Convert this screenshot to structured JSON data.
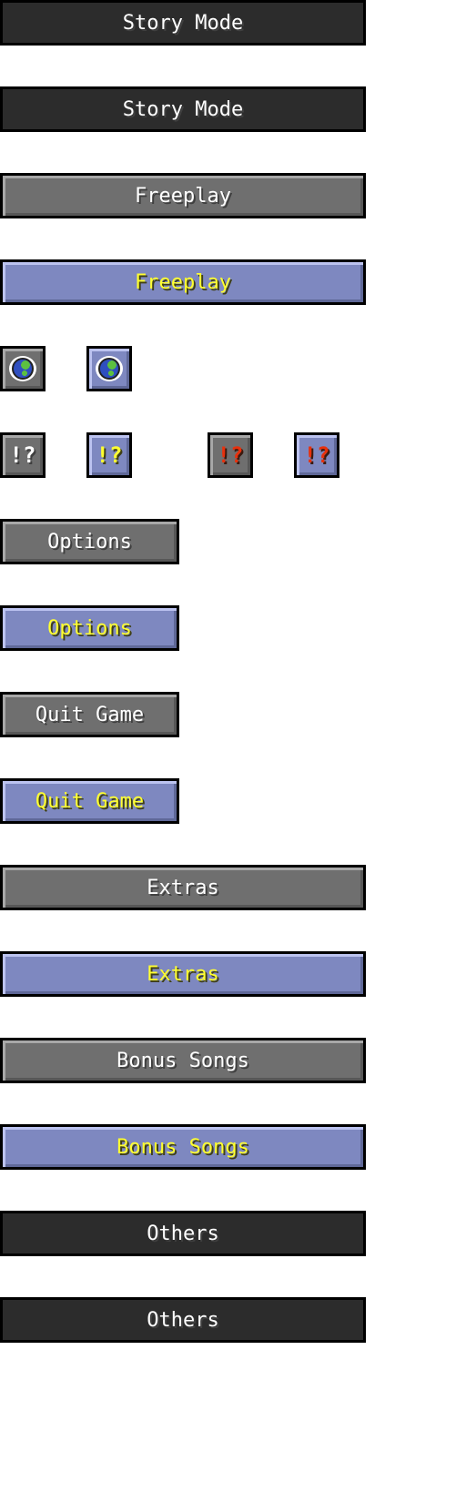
{
  "buttons": {
    "story_mode_disabled": "Story Mode",
    "story_mode_disabled_2": "Story Mode",
    "freeplay": "Freeplay",
    "freeplay_hover": "Freeplay",
    "question": "!?",
    "question_hover": "!?",
    "question_red": "!?",
    "question_red_hover": "!?",
    "options": "Options",
    "options_hover": "Options",
    "quit": "Quit Game",
    "quit_hover": "Quit Game",
    "extras": "Extras",
    "extras_hover": "Extras",
    "bonus": "Bonus Songs",
    "bonus_hover": "Bonus Songs",
    "others_disabled": "Others",
    "others_disabled_2": "Others"
  },
  "icons": {
    "language": "globe-speech-icon"
  },
  "colors": {
    "normal": "#6f6f6f",
    "hover": "#7e88c0",
    "disabled": "#2c2c2c",
    "hover_text": "#ffff30",
    "red_text": "#e8300c"
  }
}
